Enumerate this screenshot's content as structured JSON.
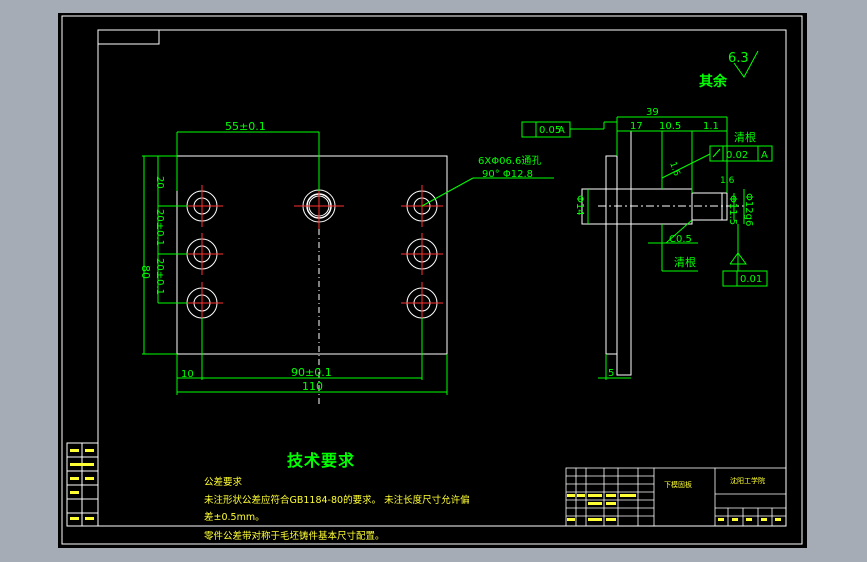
{
  "colors": {
    "background": "#000000",
    "frame": "#ffffff",
    "dimension": "#00ff00",
    "center": "#ff0000",
    "annotation": "#ffff33",
    "chrome": "#a6acb5"
  },
  "roughness": {
    "value": "6.3",
    "label": "其余"
  },
  "front_view": {
    "dim_top": "55±0.1",
    "dim_width_inner": "90±0.1",
    "dim_width_total": "110",
    "dim_left_offset": "10",
    "dim_height_total": "80",
    "dim_first_row": "20",
    "dim_pitch_1": "20±0.1",
    "dim_pitch_2": "20±0.1",
    "hole_note_line1": "6XΦ06.6通孔",
    "hole_note_line2": "90°  Φ12.8"
  },
  "side_view": {
    "dim_overall": "39",
    "dim_seg_1": "17",
    "dim_seg_2": "10.5",
    "dim_seg_3": "1.1",
    "flatness_value": "0.05",
    "flatness_datum": "A",
    "clean_root_1": "清根",
    "perp_value": "0.02",
    "perp_datum": "A",
    "roughness_small_1": "1.6",
    "roughness_small_2": "1.6",
    "dia_left": "Φ14",
    "dia_right_1": "Φ12g6",
    "dia_right_2": "Φ11.5",
    "chamfer": "C0.5",
    "clean_root_2": "清根",
    "runout_value": "0.01",
    "base_thickness": "5"
  },
  "notes": {
    "title": "技术要求",
    "line1": "公差要求",
    "line2": "未注形状公差应符合GB1184-80的要求。   未注长度尺寸允许偏",
    "line3": "差±0.5mm。",
    "line4": "零件公差带对称于毛坯铸件基本尺寸配置。"
  },
  "title_block": {
    "center_text": "下模固板",
    "right_text": "沈阳工学院"
  },
  "side_strip": [
    "",
    "",
    "",
    "",
    ""
  ]
}
